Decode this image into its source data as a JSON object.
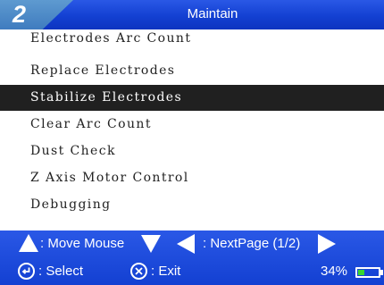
{
  "header": {
    "page_number": "2",
    "title": "Maintain"
  },
  "menu": {
    "items": [
      {
        "label": "Electrodes Arc Count",
        "selected": false
      },
      {
        "label": "Replace Electrodes",
        "selected": false
      },
      {
        "label": "Stabilize Electrodes",
        "selected": true
      },
      {
        "label": "Clear Arc Count",
        "selected": false
      },
      {
        "label": "Dust Check",
        "selected": false
      },
      {
        "label": "Z Axis Motor Control",
        "selected": false
      },
      {
        "label": "Debugging",
        "selected": false
      }
    ]
  },
  "footer": {
    "move_mouse_label": ": Move Mouse",
    "next_page_label": ": NextPage (1/2)",
    "select_label": ": Select",
    "exit_label": ": Exit",
    "battery_text": "34%",
    "battery_level": 0.34
  },
  "colors": {
    "bar_blue": "#1340d2",
    "badge_blue": "#4a86c6",
    "selected_bg": "#202020",
    "battery_green": "#38d630"
  },
  "icons": {
    "up": "triangle-up-icon",
    "down": "triangle-down-icon",
    "left": "triangle-left-icon",
    "right": "triangle-right-icon",
    "select": "enter-circle-icon",
    "exit": "x-circle-icon",
    "battery": "battery-icon"
  }
}
